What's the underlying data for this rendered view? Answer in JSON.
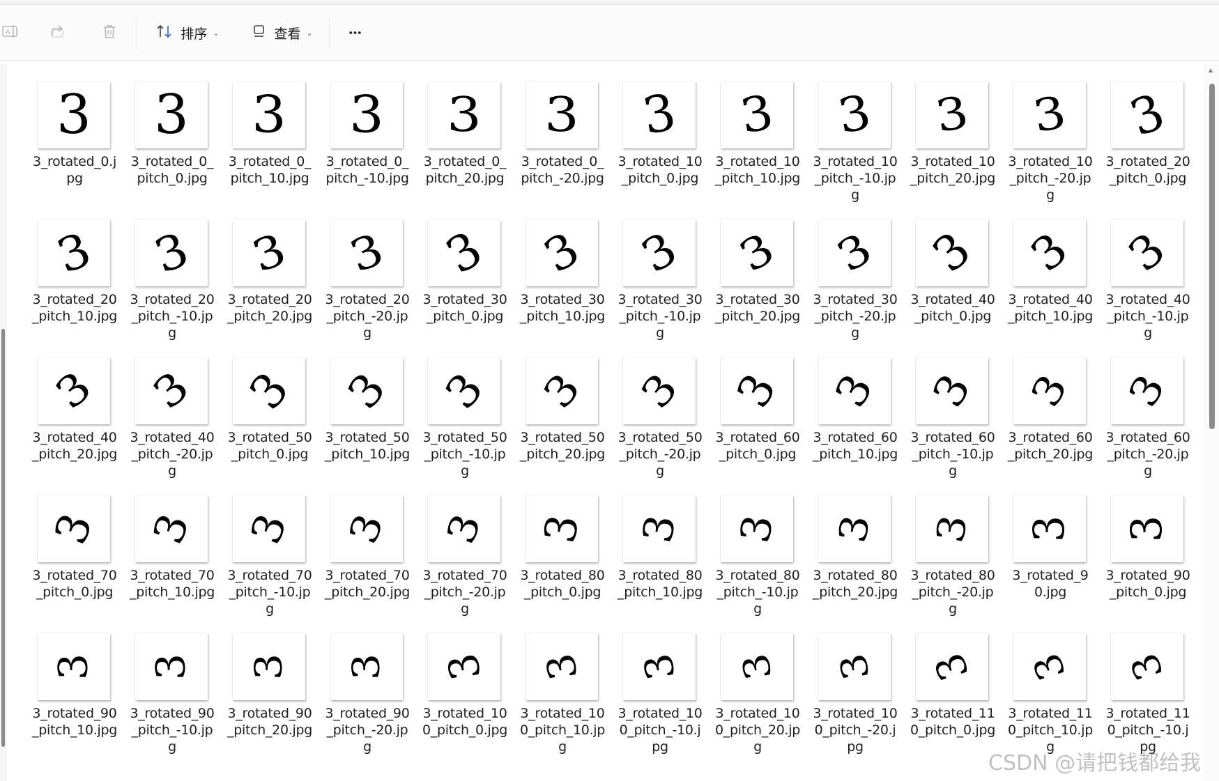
{
  "toolbar": {
    "sort_label": "排序",
    "view_label": "查看",
    "more_label": "•••"
  },
  "files": [
    "3_rotated_0.jpg",
    "3_rotated_0_pitch_0.jpg",
    "3_rotated_0_pitch_10.jpg",
    "3_rotated_0_pitch_-10.jpg",
    "3_rotated_0_pitch_20.jpg",
    "3_rotated_0_pitch_-20.jpg",
    "3_rotated_10_pitch_0.jpg",
    "3_rotated_10_pitch_10.jpg",
    "3_rotated_10_pitch_-10.jpg",
    "3_rotated_10_pitch_20.jpg",
    "3_rotated_10_pitch_-20.jpg",
    "3_rotated_20_pitch_0.jpg",
    "3_rotated_20_pitch_10.jpg",
    "3_rotated_20_pitch_-10.jpg",
    "3_rotated_20_pitch_20.jpg",
    "3_rotated_20_pitch_-20.jpg",
    "3_rotated_30_pitch_0.jpg",
    "3_rotated_30_pitch_10.jpg",
    "3_rotated_30_pitch_-10.jpg",
    "3_rotated_30_pitch_20.jpg",
    "3_rotated_30_pitch_-20.jpg",
    "3_rotated_40_pitch_0.jpg",
    "3_rotated_40_pitch_10.jpg",
    "3_rotated_40_pitch_-10.jpg",
    "3_rotated_40_pitch_20.jpg",
    "3_rotated_40_pitch_-20.jpg",
    "3_rotated_50_pitch_0.jpg",
    "3_rotated_50_pitch_10.jpg",
    "3_rotated_50_pitch_-10.jpg",
    "3_rotated_50_pitch_20.jpg",
    "3_rotated_50_pitch_-20.jpg",
    "3_rotated_60_pitch_0.jpg",
    "3_rotated_60_pitch_10.jpg",
    "3_rotated_60_pitch_-10.jpg",
    "3_rotated_60_pitch_20.jpg",
    "3_rotated_60_pitch_-20.jpg",
    "3_rotated_70_pitch_0.jpg",
    "3_rotated_70_pitch_10.jpg",
    "3_rotated_70_pitch_-10.jpg",
    "3_rotated_70_pitch_20.jpg",
    "3_rotated_70_pitch_-20.jpg",
    "3_rotated_80_pitch_0.jpg",
    "3_rotated_80_pitch_10.jpg",
    "3_rotated_80_pitch_-10.jpg",
    "3_rotated_80_pitch_20.jpg",
    "3_rotated_80_pitch_-20.jpg",
    "3_rotated_90.jpg",
    "3_rotated_90_pitch_0.jpg",
    "3_rotated_90_pitch_10.jpg",
    "3_rotated_90_pitch_-10.jpg",
    "3_rotated_90_pitch_20.jpg",
    "3_rotated_90_pitch_-20.jpg",
    "3_rotated_100_pitch_0.jpg",
    "3_rotated_100_pitch_10.jpg",
    "3_rotated_100_pitch_-10.jpg",
    "3_rotated_100_pitch_20.jpg",
    "3_rotated_100_pitch_-20.jpg",
    "3_rotated_110_pitch_0.jpg",
    "3_rotated_110_pitch_10.jpg",
    "3_rotated_110_pitch_-10.jpg"
  ],
  "thumbnail_glyph": "3",
  "watermark": "CSDN @请把钱都给我"
}
